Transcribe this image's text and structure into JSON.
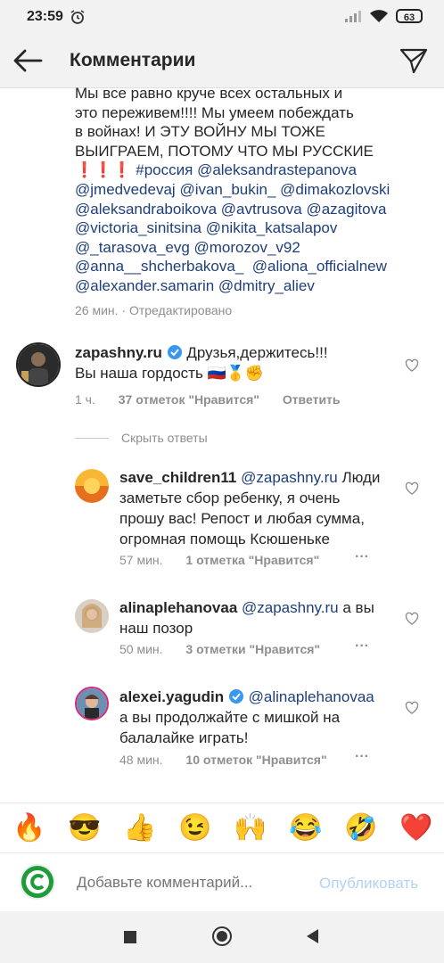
{
  "status": {
    "time": "23:59",
    "battery": "63"
  },
  "header": {
    "title": "Комментарии"
  },
  "caption": {
    "line1": "Мы все равно круче всех остальных и",
    "line2": "это переживем!!!! Мы умеем побеждать",
    "line3": "в войнах! И ЭТУ ВОЙНУ МЫ ТОЖЕ",
    "line4": "ВЫИГРАЕМ, ПОТОМУ ЧТО МЫ РУССКИЕ",
    "exclam": "❗❗❗",
    "hashtag": "#россия",
    "mentions": [
      "@aleksandrastepanova",
      "@jmedvedevaj",
      "@ivan_bukin_",
      "@dimakozlovski",
      "@aleksandraboikova",
      "@avtrusova",
      "@azagitova",
      "@victoria_sinitsina",
      "@nikita_katsalapov",
      "@_tarasova_evg",
      "@morozov_v92",
      "@anna__shcherbakova_",
      "@aliona_officialnew",
      "@alexander.samarin",
      "@dmitry_aliev"
    ],
    "meta": "26 мин. · Отредактировано"
  },
  "comments": [
    {
      "user": "zapashny.ru",
      "text1": "Друзья,держитесь!!!",
      "text2": "Вы наша гордость 🇷🇺🥇✊",
      "time": "1 ч.",
      "likes": "37 отметок \"Нравится\"",
      "reply": "Ответить"
    }
  ],
  "hide_replies": "Скрыть ответы",
  "replies": [
    {
      "user": "save_children11",
      "mention": "@zapashny.ru",
      "text_first": "Люди",
      "lines": [
        "заметьте сбор ребенку, я очень",
        "прошу вас!  Репост и любая сумма,",
        "огромная помощь Ксюшеньке"
      ],
      "time": "57 мин.",
      "likes": "1 отметка \"Нравится\""
    },
    {
      "user": "alinaplehanovaa",
      "mention": "@zapashny.ru",
      "text_first": "а вы",
      "lines": [
        "наш позор"
      ],
      "time": "50 мин.",
      "likes": "3 отметки \"Нравится\""
    },
    {
      "user": "alexei.yagudin",
      "mention": "@alinaplehanovaa",
      "text_first": "",
      "lines": [
        "а вы продолжайте с мишкой на",
        "балалайке играть!"
      ],
      "time": "48 мин.",
      "likes": "10 отметок \"Нравится\""
    }
  ],
  "emojis": [
    "🔥",
    "😎",
    "👍",
    "😉",
    "🙌",
    "😂",
    "🤣",
    "❤️"
  ],
  "input": {
    "placeholder": "Добавьте комментарий...",
    "publish": "Опубликовать"
  }
}
